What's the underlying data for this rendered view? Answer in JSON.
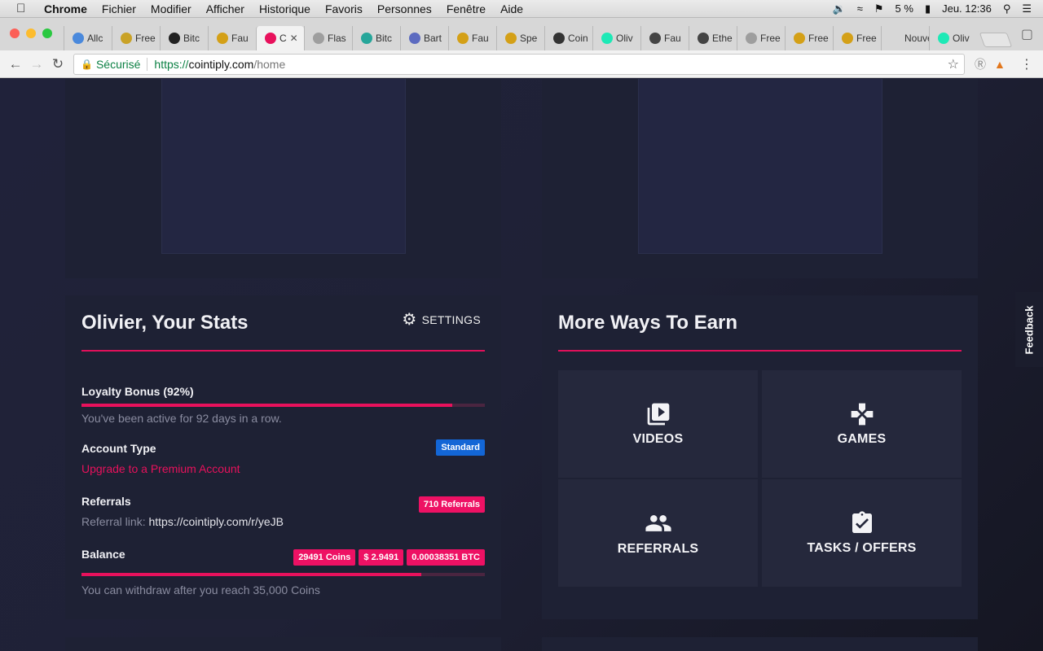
{
  "menubar": {
    "app": "Chrome",
    "items": [
      "Fichier",
      "Modifier",
      "Afficher",
      "Historique",
      "Favoris",
      "Personnes",
      "Fenêtre",
      "Aide"
    ],
    "battery": "5 %",
    "clock": "Jeu. 12:36"
  },
  "tabs": [
    {
      "label": "Allc",
      "color": "#4a89dc"
    },
    {
      "label": "Free",
      "color": "#c9a227"
    },
    {
      "label": "Bitc",
      "color": "#222222"
    },
    {
      "label": "Fau",
      "color": "#d4a017"
    },
    {
      "label": "C",
      "color": "#e8115c",
      "active": true
    },
    {
      "label": "Flas",
      "color": "#9e9e9e"
    },
    {
      "label": "Bitc",
      "color": "#26a69a"
    },
    {
      "label": "Bart",
      "color": "#5c6bc0"
    },
    {
      "label": "Fau",
      "color": "#d4a017"
    },
    {
      "label": "Spe",
      "color": "#d4a017"
    },
    {
      "label": "Coin",
      "color": "#333333"
    },
    {
      "label": "Oliv",
      "color": "#1de9b6"
    },
    {
      "label": "Fau",
      "color": "#444444"
    },
    {
      "label": "Ethe",
      "color": "#444444"
    },
    {
      "label": "Free",
      "color": "#9e9e9e"
    },
    {
      "label": "Free",
      "color": "#d4a017"
    },
    {
      "label": "Free",
      "color": "#d4a017"
    },
    {
      "label": "Nouvel",
      "color": "#d7d7d7"
    },
    {
      "label": "Oliv",
      "color": "#1de9b6"
    }
  ],
  "omnibox": {
    "secure_label": "Sécurisé",
    "scheme": "https://",
    "host": "cointiply.com",
    "path": "/home"
  },
  "stats": {
    "title": "Olivier, Your Stats",
    "settings_label": "SETTINGS",
    "loyalty_label": "Loyalty Bonus (92%)",
    "loyalty_progress": 0.92,
    "loyalty_sub": "You've been active for 92 days in a row.",
    "account_type_label": "Account Type",
    "account_type_badge": "Standard",
    "upgrade_link": "Upgrade to a Premium Account",
    "referrals_label": "Referrals",
    "referrals_badge": "710 Referrals",
    "referral_link_label": "Referral link:",
    "referral_link": "https://cointiply.com/r/yeJB",
    "balance_label": "Balance",
    "balance_coins": "29491 Coins",
    "balance_usd": "$ 2.9491",
    "balance_btc": "0.00038351 BTC",
    "balance_progress": 0.8426,
    "withdraw_note": "You can withdraw after you reach 35,000 Coins"
  },
  "earn": {
    "title": "More Ways To Earn",
    "tiles": [
      {
        "label": "VIDEOS"
      },
      {
        "label": "GAMES"
      },
      {
        "label": "REFERRALS"
      },
      {
        "label": "TASKS / OFFERS"
      }
    ]
  },
  "feedback": "Feedback"
}
